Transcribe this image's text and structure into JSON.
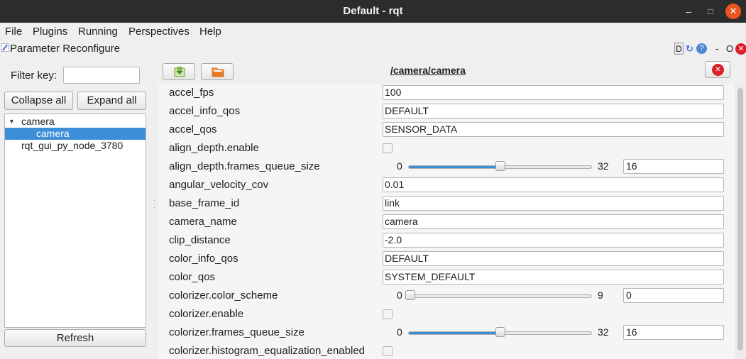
{
  "window": {
    "title": "Default - rqt",
    "minimize_glyph": "–",
    "maximize_glyph": "□",
    "close_glyph": "✕"
  },
  "menu": [
    {
      "label": "File"
    },
    {
      "label": "Plugins"
    },
    {
      "label": "Running"
    },
    {
      "label": "Perspectives"
    },
    {
      "label": "Help"
    }
  ],
  "plugin": {
    "title": "Parameter Reconfigure",
    "controls": {
      "d": "D",
      "dash": "-",
      "o": "O",
      "help": "?",
      "close": "✕"
    }
  },
  "filter": {
    "label": "Filter key:",
    "value": ""
  },
  "buttons": {
    "collapse": "Collapse all",
    "expand": "Expand all",
    "refresh": "Refresh"
  },
  "tree": [
    {
      "label": "camera",
      "expanded": true,
      "selected": false
    },
    {
      "label": "camera",
      "expanded": false,
      "selected": true
    },
    {
      "label": "rqt_gui_py_node_3780",
      "expanded": false,
      "selected": false
    }
  ],
  "node_path": "/camera/camera",
  "params": [
    {
      "name": "accel_fps",
      "kind": "text",
      "value": "100"
    },
    {
      "name": "accel_info_qos",
      "kind": "text",
      "value": "DEFAULT"
    },
    {
      "name": "accel_qos",
      "kind": "text",
      "value": "SENSOR_DATA"
    },
    {
      "name": "align_depth.enable",
      "kind": "bool",
      "value": false
    },
    {
      "name": "align_depth.frames_queue_size",
      "kind": "slider",
      "min": "0",
      "max": "32",
      "value": "16",
      "level": 0.5
    },
    {
      "name": "angular_velocity_cov",
      "kind": "text",
      "value": "0.01"
    },
    {
      "name": "base_frame_id",
      "kind": "text",
      "value": "link"
    },
    {
      "name": "camera_name",
      "kind": "text",
      "value": "camera"
    },
    {
      "name": "clip_distance",
      "kind": "text",
      "value": "-2.0"
    },
    {
      "name": "color_info_qos",
      "kind": "text",
      "value": "DEFAULT"
    },
    {
      "name": "color_qos",
      "kind": "text",
      "value": "SYSTEM_DEFAULT"
    },
    {
      "name": "colorizer.color_scheme",
      "kind": "slider",
      "min": "0",
      "max": "9",
      "value": "0",
      "level": 0.0
    },
    {
      "name": "colorizer.enable",
      "kind": "bool",
      "value": false
    },
    {
      "name": "colorizer.frames_queue_size",
      "kind": "slider",
      "min": "0",
      "max": "32",
      "value": "16",
      "level": 0.5
    },
    {
      "name": "colorizer.histogram_equalization_enabled",
      "kind": "bool",
      "value": false
    }
  ],
  "colors": {
    "selection": "#3d8ed8",
    "titlebar": "#2c2c2c",
    "close": "#e9541f"
  }
}
